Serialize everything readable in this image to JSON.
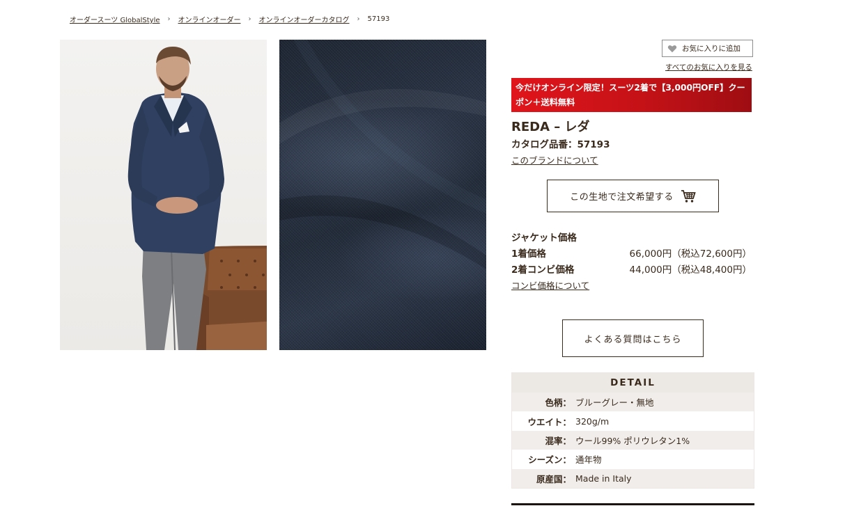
{
  "breadcrumb": {
    "items": [
      "オーダースーツ GlobalStyle",
      "オンラインオーダー",
      "オンラインオーダーカタログ"
    ],
    "current": "57193",
    "separator": "›"
  },
  "favorites": {
    "add_label": "お気に入りに追加",
    "view_all_label": "すべてのお気に入りを見る"
  },
  "promo": {
    "text": "今だけオンライン限定！スーツ2着で【3,000円OFF】クーポン＋送料無料",
    "color_start": "#e0151b",
    "color_end": "#9e0d12"
  },
  "product": {
    "title": "REDA – レダ",
    "catalog_number": "カタログ品番：57193",
    "brand_link": "このブランドについて",
    "order_button": "この生地で注文希望する"
  },
  "pricing": {
    "heading": "ジャケット価格",
    "rows": [
      {
        "label": "1着価格",
        "value": "66,000円（税込72,600円）"
      },
      {
        "label": "2着コンビ価格",
        "value": "44,000円（税込48,400円）"
      }
    ],
    "combi_link": "コンビ価格について"
  },
  "faq_button": "よくある質問はこちら",
  "detail": {
    "heading": "DETAIL",
    "rows": [
      {
        "label": "色柄：",
        "value": "ブルーグレー・無地"
      },
      {
        "label": "ウエイト：",
        "value": "320g/m"
      },
      {
        "label": "混率：",
        "value": "ウール99% ポリウレタン1%"
      },
      {
        "label": "シーズン：",
        "value": "通年物"
      },
      {
        "label": "原産国：",
        "value": "Made in Italy"
      }
    ]
  },
  "icons": {
    "favorite": "heart-icon",
    "cart": "cart-icon"
  },
  "colors": {
    "text": "#3a2a1c",
    "detail_header_bg": "#ece8e4",
    "fabric": "#242d3b"
  }
}
